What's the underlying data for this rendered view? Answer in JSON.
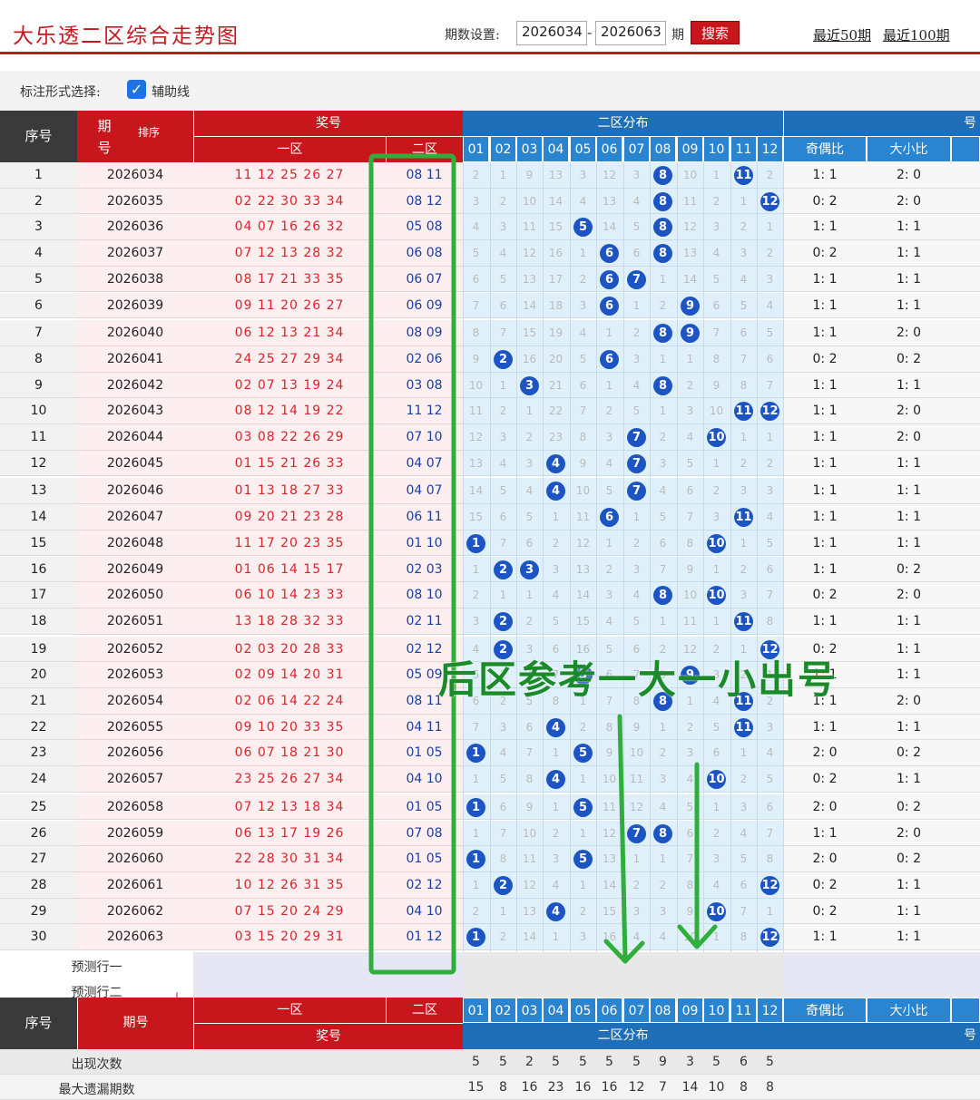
{
  "header": {
    "title": "大乐透二区综合走势图",
    "period_label": "期数设置:",
    "from": "2026034",
    "to": "2026063",
    "qi": "期",
    "search": "搜索",
    "recent50": "最近50期",
    "recent100": "最近100期"
  },
  "options": {
    "label": "标注形式选择:",
    "aux": "辅助线"
  },
  "table": {
    "h_seq": "序号",
    "h_issue": "期\n号",
    "h_sort": "排序",
    "h_prize": "奖号",
    "h_zone1": "一区",
    "h_zone2": "二区",
    "h_dist": "二区分布",
    "h_right": "号",
    "h_odd": "奇偶比",
    "h_big": "大小比",
    "cols": [
      "01",
      "02",
      "03",
      "04",
      "05",
      "06",
      "07",
      "08",
      "09",
      "10",
      "11",
      "12"
    ],
    "rows": [
      {
        "n": "1",
        "issue": "2026034",
        "z1": "11 12 25 26 27",
        "z2": "08 11",
        "om": [
          "2",
          "1",
          "9",
          "13",
          "3",
          "12",
          "3",
          "",
          "10",
          "1",
          "",
          "2"
        ],
        "odd": "1: 1",
        "big": "2: 0"
      },
      {
        "n": "2",
        "issue": "2026035",
        "z1": "02 22 30 33 34",
        "z2": "08 12",
        "om": [
          "3",
          "2",
          "10",
          "14",
          "4",
          "13",
          "4",
          "",
          "11",
          "2",
          "1",
          ""
        ],
        "odd": "0: 2",
        "big": "2: 0"
      },
      {
        "n": "3",
        "issue": "2026036",
        "z1": "04 07 16 26 32",
        "z2": "05 08",
        "om": [
          "4",
          "3",
          "11",
          "15",
          "",
          "14",
          "5",
          "",
          "12",
          "3",
          "2",
          "1"
        ],
        "odd": "1: 1",
        "big": "1: 1"
      },
      {
        "n": "4",
        "issue": "2026037",
        "z1": "07 12 13 28 32",
        "z2": "06 08",
        "om": [
          "5",
          "4",
          "12",
          "16",
          "1",
          "",
          "6",
          "",
          "13",
          "4",
          "3",
          "2"
        ],
        "odd": "0: 2",
        "big": "1: 1"
      },
      {
        "n": "5",
        "issue": "2026038",
        "z1": "08 17 21 33 35",
        "z2": "06 07",
        "om": [
          "6",
          "5",
          "13",
          "17",
          "2",
          "",
          "",
          "1",
          "14",
          "5",
          "4",
          "3"
        ],
        "odd": "1: 1",
        "big": "1: 1"
      },
      {
        "n": "6",
        "issue": "2026039",
        "z1": "09 11 20 26 27",
        "z2": "06 09",
        "om": [
          "7",
          "6",
          "14",
          "18",
          "3",
          "",
          "1",
          "2",
          "",
          "6",
          "5",
          "4"
        ],
        "odd": "1: 1",
        "big": "1: 1"
      },
      {
        "n": "7",
        "issue": "2026040",
        "z1": "06 12 13 21 34",
        "z2": "08 09",
        "om": [
          "8",
          "7",
          "15",
          "19",
          "4",
          "1",
          "2",
          "",
          "",
          "7",
          "6",
          "5"
        ],
        "odd": "1: 1",
        "big": "2: 0"
      },
      {
        "n": "8",
        "issue": "2026041",
        "z1": "24 25 27 29 34",
        "z2": "02 06",
        "om": [
          "9",
          "",
          "16",
          "20",
          "5",
          "",
          "3",
          "1",
          "1",
          "8",
          "7",
          "6"
        ],
        "odd": "0: 2",
        "big": "0: 2"
      },
      {
        "n": "9",
        "issue": "2026042",
        "z1": "02 07 13 19 24",
        "z2": "03 08",
        "om": [
          "10",
          "1",
          "",
          "21",
          "6",
          "1",
          "4",
          "",
          "2",
          "9",
          "8",
          "7"
        ],
        "odd": "1: 1",
        "big": "1: 1"
      },
      {
        "n": "10",
        "issue": "2026043",
        "z1": "08 12 14 19 22",
        "z2": "11 12",
        "om": [
          "11",
          "2",
          "1",
          "22",
          "7",
          "2",
          "5",
          "1",
          "3",
          "10",
          "",
          ""
        ],
        "odd": "1: 1",
        "big": "2: 0"
      },
      {
        "n": "11",
        "issue": "2026044",
        "z1": "03 08 22 26 29",
        "z2": "07 10",
        "om": [
          "12",
          "3",
          "2",
          "23",
          "8",
          "3",
          "",
          "2",
          "4",
          "",
          "1",
          "1"
        ],
        "odd": "1: 1",
        "big": "2: 0"
      },
      {
        "n": "12",
        "issue": "2026045",
        "z1": "01 15 21 26 33",
        "z2": "04 07",
        "om": [
          "13",
          "4",
          "3",
          "",
          "9",
          "4",
          "",
          "3",
          "5",
          "1",
          "2",
          "2"
        ],
        "odd": "1: 1",
        "big": "1: 1"
      },
      {
        "n": "13",
        "issue": "2026046",
        "z1": "01 13 18 27 33",
        "z2": "04 07",
        "om": [
          "14",
          "5",
          "4",
          "",
          "10",
          "5",
          "",
          "4",
          "6",
          "2",
          "3",
          "3"
        ],
        "odd": "1: 1",
        "big": "1: 1"
      },
      {
        "n": "14",
        "issue": "2026047",
        "z1": "09 20 21 23 28",
        "z2": "06 11",
        "om": [
          "15",
          "6",
          "5",
          "1",
          "11",
          "",
          "1",
          "5",
          "7",
          "3",
          "",
          "4"
        ],
        "odd": "1: 1",
        "big": "1: 1"
      },
      {
        "n": "15",
        "issue": "2026048",
        "z1": "11 17 20 23 35",
        "z2": "01 10",
        "om": [
          "",
          "7",
          "6",
          "2",
          "12",
          "1",
          "2",
          "6",
          "8",
          "",
          "1",
          "5"
        ],
        "odd": "1: 1",
        "big": "1: 1"
      },
      {
        "n": "16",
        "issue": "2026049",
        "z1": "01 06 14 15 17",
        "z2": "02 03",
        "om": [
          "1",
          "",
          "",
          "3",
          "13",
          "2",
          "3",
          "7",
          "9",
          "1",
          "2",
          "6"
        ],
        "odd": "1: 1",
        "big": "0: 2"
      },
      {
        "n": "17",
        "issue": "2026050",
        "z1": "06 10 14 23 33",
        "z2": "08 10",
        "om": [
          "2",
          "1",
          "1",
          "4",
          "14",
          "3",
          "4",
          "",
          "10",
          "",
          "3",
          "7"
        ],
        "odd": "0: 2",
        "big": "2: 0"
      },
      {
        "n": "18",
        "issue": "2026051",
        "z1": "13 18 28 32 33",
        "z2": "02 11",
        "om": [
          "3",
          "",
          "2",
          "5",
          "15",
          "4",
          "5",
          "1",
          "11",
          "1",
          "",
          "8"
        ],
        "odd": "1: 1",
        "big": "1: 1"
      },
      {
        "n": "19",
        "issue": "2026052",
        "z1": "02 03 20 28 33",
        "z2": "02 12",
        "om": [
          "4",
          "",
          "3",
          "6",
          "16",
          "5",
          "6",
          "2",
          "12",
          "2",
          "1",
          ""
        ],
        "odd": "0: 2",
        "big": "1: 1"
      },
      {
        "n": "20",
        "issue": "2026053",
        "z1": "02 09 14 20 31",
        "z2": "05 09",
        "om": [
          "5",
          "1",
          "4",
          "7",
          "",
          "6",
          "7",
          "3",
          "",
          "3",
          "2",
          "1"
        ],
        "odd": "1: 1",
        "big": "1: 1"
      },
      {
        "n": "21",
        "issue": "2026054",
        "z1": "02 06 14 22 24",
        "z2": "08 11",
        "om": [
          "6",
          "2",
          "5",
          "8",
          "1",
          "7",
          "8",
          "",
          "1",
          "4",
          "",
          "2"
        ],
        "odd": "1: 1",
        "big": "2: 0"
      },
      {
        "n": "22",
        "issue": "2026055",
        "z1": "09 10 20 33 35",
        "z2": "04 11",
        "om": [
          "7",
          "3",
          "6",
          "",
          "2",
          "8",
          "9",
          "1",
          "2",
          "5",
          "",
          "3"
        ],
        "odd": "1: 1",
        "big": "1: 1"
      },
      {
        "n": "23",
        "issue": "2026056",
        "z1": "06 07 18 21 30",
        "z2": "01 05",
        "om": [
          "",
          "4",
          "7",
          "1",
          "",
          "9",
          "10",
          "2",
          "3",
          "6",
          "1",
          "4"
        ],
        "odd": "2: 0",
        "big": "0: 2"
      },
      {
        "n": "24",
        "issue": "2026057",
        "z1": "23 25 26 27 34",
        "z2": "04 10",
        "om": [
          "1",
          "5",
          "8",
          "",
          "1",
          "10",
          "11",
          "3",
          "4",
          "",
          "2",
          "5"
        ],
        "odd": "0: 2",
        "big": "1: 1"
      },
      {
        "n": "25",
        "issue": "2026058",
        "z1": "07 12 13 18 34",
        "z2": "01 05",
        "om": [
          "",
          "6",
          "9",
          "1",
          "",
          "11",
          "12",
          "4",
          "5",
          "1",
          "3",
          "6"
        ],
        "odd": "2: 0",
        "big": "0: 2"
      },
      {
        "n": "26",
        "issue": "2026059",
        "z1": "06 13 17 19 26",
        "z2": "07 08",
        "om": [
          "1",
          "7",
          "10",
          "2",
          "1",
          "12",
          "",
          "",
          "6",
          "2",
          "4",
          "7"
        ],
        "odd": "1: 1",
        "big": "2: 0"
      },
      {
        "n": "27",
        "issue": "2026060",
        "z1": "22 28 30 31 34",
        "z2": "01 05",
        "om": [
          "",
          "8",
          "11",
          "3",
          "",
          "13",
          "1",
          "1",
          "7",
          "3",
          "5",
          "8"
        ],
        "odd": "2: 0",
        "big": "0: 2"
      },
      {
        "n": "28",
        "issue": "2026061",
        "z1": "10 12 26 31 35",
        "z2": "02 12",
        "om": [
          "1",
          "",
          "12",
          "4",
          "1",
          "14",
          "2",
          "2",
          "8",
          "4",
          "6",
          ""
        ],
        "odd": "0: 2",
        "big": "1: 1"
      },
      {
        "n": "29",
        "issue": "2026062",
        "z1": "07 15 20 24 29",
        "z2": "04 10",
        "om": [
          "2",
          "1",
          "13",
          "",
          "2",
          "15",
          "3",
          "3",
          "9",
          "",
          "7",
          "1"
        ],
        "odd": "0: 2",
        "big": "1: 1"
      },
      {
        "n": "30",
        "issue": "2026063",
        "z1": "03 15 20 29 31",
        "z2": "01 12",
        "om": [
          "",
          "2",
          "14",
          "1",
          "3",
          "16",
          "4",
          "4",
          "10",
          "1",
          "8",
          ""
        ],
        "odd": "1: 1",
        "big": "1: 1"
      }
    ],
    "predict1": "预测行一",
    "predict2": "预测行二",
    "footer": {
      "seq": "序号",
      "issue": "期号",
      "zone1": "一区",
      "zone2": "二区",
      "prize": "奖号",
      "dist": "二区分布",
      "odd": "奇偶比",
      "big": "大小比",
      "right": "号"
    },
    "stats": [
      {
        "label": "出现次数",
        "values": [
          "5",
          "5",
          "2",
          "5",
          "5",
          "5",
          "5",
          "9",
          "3",
          "5",
          "6",
          "5"
        ]
      },
      {
        "label": "最大遗漏期数",
        "values": [
          "15",
          "8",
          "16",
          "23",
          "16",
          "16",
          "12",
          "7",
          "14",
          "10",
          "8",
          "8"
        ]
      }
    ]
  },
  "annotation": {
    "text": "后区参考一大一小出号",
    "color": "#1a8a2a"
  },
  "colors": {
    "brand_red": "#c8161d",
    "ball_blue": "#1d54c4",
    "grid_bg": "#dff0fb"
  }
}
